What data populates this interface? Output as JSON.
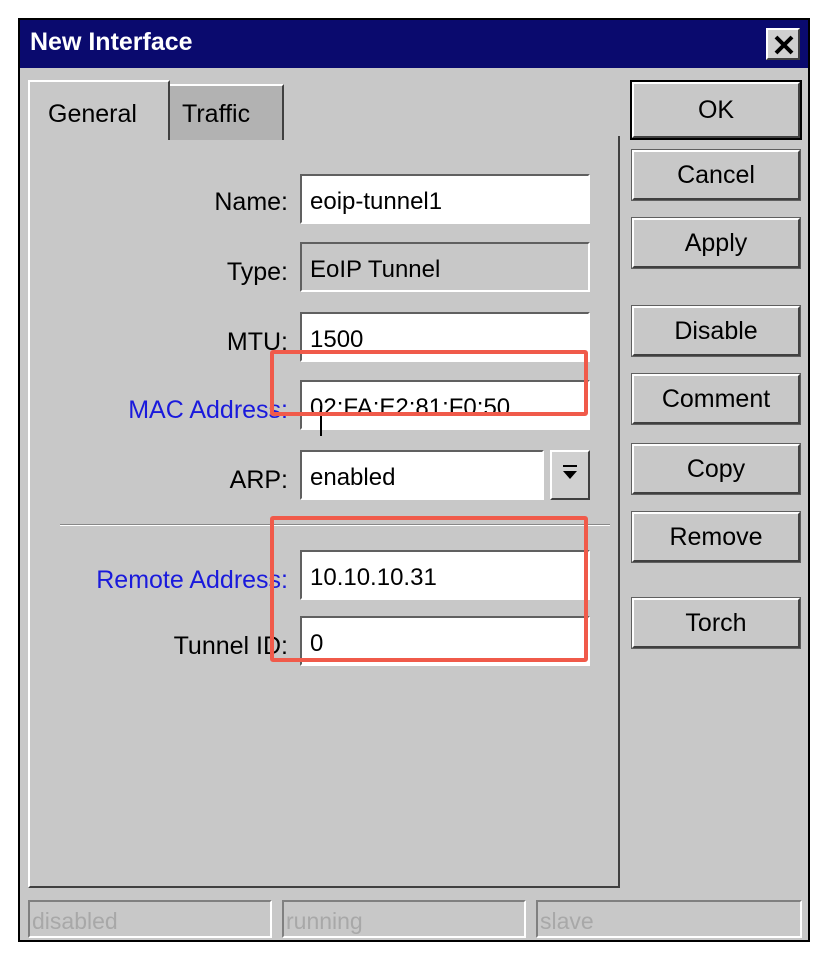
{
  "window": {
    "title": "New Interface"
  },
  "tabs": [
    {
      "label": "General",
      "active": true
    },
    {
      "label": "Traffic",
      "active": false
    }
  ],
  "form": {
    "name": {
      "label": "Name:",
      "value": "eoip-tunnel1"
    },
    "type": {
      "label": "Type:",
      "value": "EoIP Tunnel"
    },
    "mtu": {
      "label": "MTU:",
      "value": "1500"
    },
    "mac_address": {
      "label": "MAC Address:",
      "value": "02:FA:E2:81:F0:50"
    },
    "arp": {
      "label": "ARP:",
      "value": "enabled"
    },
    "remote_address": {
      "label": "Remote Address:",
      "value": "10.10.10.31"
    },
    "tunnel_id": {
      "label": "Tunnel ID:",
      "value": "0"
    }
  },
  "buttons": {
    "ok": "OK",
    "cancel": "Cancel",
    "apply": "Apply",
    "disable": "Disable",
    "comment": "Comment",
    "copy": "Copy",
    "remove": "Remove",
    "torch": "Torch"
  },
  "status_bar": [
    "disabled",
    "running",
    "slave"
  ],
  "colors": {
    "title_bar": "#0a0a6e",
    "highlight": "#f05a4a",
    "blue_label": "#1a1adc"
  }
}
